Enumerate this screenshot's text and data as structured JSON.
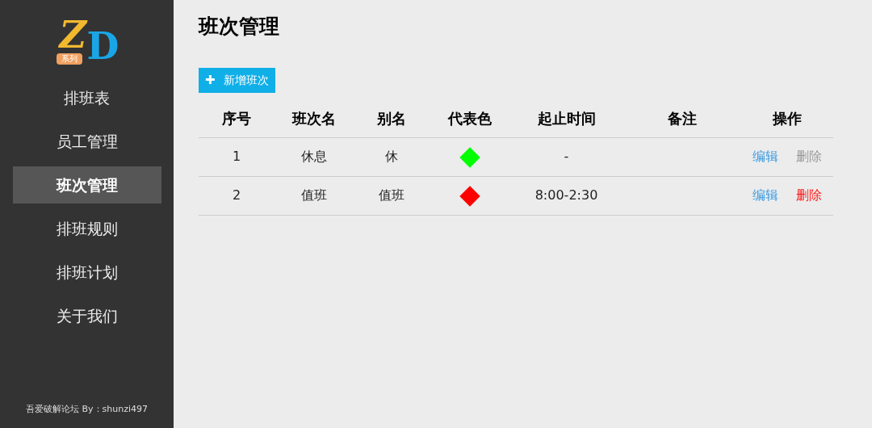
{
  "logo": {
    "letters": [
      "Z",
      "D"
    ],
    "tag": "系列"
  },
  "sidebar": {
    "items": [
      {
        "label": "排班表",
        "selected": false
      },
      {
        "label": "员工管理",
        "selected": false
      },
      {
        "label": "班次管理",
        "selected": true
      },
      {
        "label": "排班规则",
        "selected": false
      },
      {
        "label": "排班计划",
        "selected": false
      },
      {
        "label": "关于我们",
        "selected": false
      }
    ],
    "footer": "吾爱破解论坛 By：shunzi497"
  },
  "page_title": "班次管理",
  "add_button": {
    "icon": "✚",
    "label": "新增班次"
  },
  "table": {
    "columns": [
      "序号",
      "班次名",
      "别名",
      "代表色",
      "起止时间",
      "备注",
      "操作"
    ],
    "rows": [
      {
        "index": "1",
        "name": "休息",
        "alias": "休",
        "color": "#00ff00",
        "time": "-",
        "edit": "编辑",
        "delete": "删除",
        "delete_disabled": true
      },
      {
        "index": "2",
        "name": "值班",
        "alias": "值班",
        "color": "#ff0000",
        "time": "8:00-2:30",
        "edit": "编辑",
        "delete": "删除",
        "delete_disabled": false
      }
    ]
  }
}
